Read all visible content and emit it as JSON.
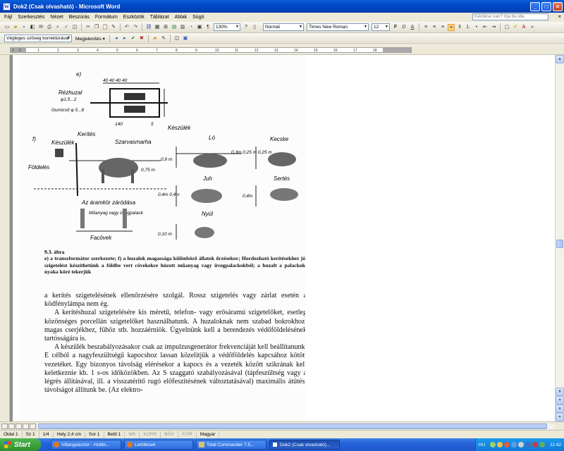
{
  "window": {
    "title": "Dok2 (Csak olvasható) - Microsoft Word",
    "app_icon": "W"
  },
  "menu": {
    "items": [
      "Fájl",
      "Szerkesztés",
      "Nézet",
      "Beszúrás",
      "Formátum",
      "Eszközök",
      "Táblázat",
      "Ablak",
      "Súgó"
    ],
    "help_placeholder": "Kérdése van? Írja be ide.",
    "close_glyph": "×"
  },
  "toolbar1": {
    "zoom": "130%",
    "style": "Normál",
    "font": "Times New Roman",
    "size": "12"
  },
  "toolbar2": {
    "review_mode": "Végleges szöveg korrektúrával",
    "show_label": "Megjelenítés ▾"
  },
  "ruler": {
    "ticks": [
      "1",
      "2",
      "1",
      "2",
      "3",
      "4",
      "5",
      "6",
      "7",
      "8",
      "9",
      "10",
      "11",
      "12",
      "13",
      "14",
      "15",
      "16",
      "17",
      "18"
    ]
  },
  "status": {
    "page": "Oldal  1",
    "section": "Sz  1",
    "pages": "1/4",
    "position": "Hely  2,4 cm",
    "line": "Sor  1",
    "column": "Betű  1",
    "rec": "MR",
    "trk": "KORR",
    "ext": "BŐV",
    "ovr": "ÁTÍR",
    "language": "Magyar"
  },
  "taskbar": {
    "start": "Start",
    "tasks": [
      {
        "label": "Villanypásztor - Hobbi...",
        "active": false
      },
      {
        "label": "Letöltések",
        "active": false
      },
      {
        "label": "Total Commander 7.5...",
        "active": false
      },
      {
        "label": "Dok2 (Csak olvasható)...",
        "active": true
      }
    ],
    "language": "HU",
    "clock": "11:42"
  },
  "document": {
    "fig_label_e": "e)",
    "fig_label_f": "f)",
    "dim_top": "40   40   40   40",
    "label_rezhuzal": "Rézhuzal",
    "label_rezhuzal_dim": "φ1,5...2",
    "label_gumicso": "Gumicső φ 5...8",
    "dim_140": "140",
    "dim_5": "5",
    "label_keszulek": "Készülék",
    "label_keszulek2": "Készülék",
    "label_kerites": "Kerítés",
    "label_szarvasmarha": "Szarvasmarha",
    "label_foldeles": "Földelés",
    "dim_075": "0,75 m",
    "label_lo": "Ló",
    "label_kecske": "Kecske",
    "dim_09": "0,9 m",
    "dim_kecske": "0,3m 0,25 m 0,25 m",
    "label_az_aramkor": "Az áramkör záródása",
    "label_juh": "Juh",
    "label_sertes": "Sertés",
    "dim_juh": "0,4m 0,4m",
    "dim_sertes": "0,4m",
    "label_muanyag": "Műanyag vagy üvegpalack",
    "label_nyul": "Nyúl",
    "dim_nyul": "0,10 m",
    "label_facovek": "Facövek",
    "caption_title": "9.3. ábra",
    "caption_text": "e) a transzformátor szerkezete; f) a huzalok magassága különböző állatok őrzésekor; Hordozható kerítésekhez jó szigetelést készíthetünk a földbe vert cövekekre húzott műanyag vagy üvegpalackokból; a huzalt a palackok nyaka köré tekerjük",
    "p1": "a kerítés szigetelésének ellenőrzésére szolgál. Rossz szigetelés vagy zárlat esetén a ködfénylámpa nem ég.",
    "p2": "A kerítéshuzal szigetelésére kis méretű, telefon- vagy erősáramú szigetelőket, esetleg közönséges porcellán szigetelőket használhatunk. A huzaloknak nem szabad bokrokhoz, magas cserjékhez, fűhöz stb. hozzáérniök. Ügyelnünk kell a berendezés védőföldelésének tartósságára is.",
    "p3": "A készülék beszabályozásakor csak az impulzusgenerátor frekvenciáját kell beállítanunk. E célból a nagyfeszültségű kapocshoz lassan közelítjük a védőföldelés kapcsához kötött vezetéket. Egy bizonyos távolság elérésekor a kapocs és a vezeték között szikrának kell keletkeznie kb. 1 s-os időközökben. Az S szaggató szabályozásával (tápfeszültség vagy a légrés állításával, ill. a visszatérítő rugó előfeszítésének változtatásával) maximális átütési távolságot állítunk be. (Az elektro-"
  }
}
